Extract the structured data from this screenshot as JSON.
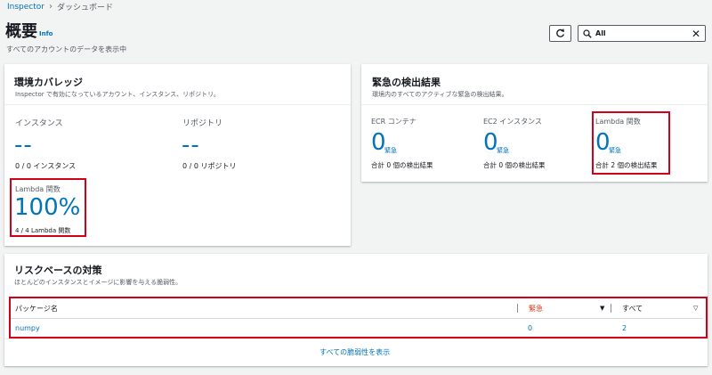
{
  "breadcrumb": {
    "root": "Inspector",
    "current": "ダッシュボード"
  },
  "header": {
    "title": "概要",
    "info": "Info",
    "description": "すべてのアカウントのデータを表示中",
    "search_value": "All"
  },
  "coverage": {
    "title": "環境カバレッジ",
    "subtitle": "Inspector で有効になっているアカウント、インスタンス、リポジトリ。",
    "instances": {
      "label": "インスタンス",
      "value": "--",
      "sub": "0 / 0 インスタンス"
    },
    "repositories": {
      "label": "リポジトリ",
      "value": "--",
      "sub": "0 / 0 リポジトリ"
    },
    "lambda": {
      "label": "Lambda 関数",
      "value": "100%",
      "sub": "4 / 4 Lambda 関数"
    }
  },
  "critical": {
    "title": "緊急の検出結果",
    "subtitle": "環境内のすべてのアクティブな緊急の検出結果。",
    "ecr": {
      "label": "ECR コンテナ",
      "value": "0",
      "unit": "緊急",
      "sub": "合計 0 個の検出結果"
    },
    "ec2": {
      "label": "EC2 インスタンス",
      "value": "0",
      "unit": "緊急",
      "sub": "合計 0 個の検出結果"
    },
    "lambda": {
      "label": "Lambda 関数",
      "value": "0",
      "unit": "緊急",
      "sub": "合計 2 個の検出結果"
    }
  },
  "risk": {
    "title": "リスクベースの対策",
    "subtitle": "ほとんどのインスタンスとイメージに影響を与える脆弱性。",
    "columns": {
      "package": "パッケージ名",
      "critical": "緊急",
      "all": "すべて"
    },
    "rows": [
      {
        "package": "numpy",
        "critical": "0",
        "all": "2"
      }
    ],
    "footer_link": "すべての脆弱性を表示"
  },
  "colors": {
    "link": "#0073bb",
    "critical": "#d13212",
    "highlight": "#d0021b"
  }
}
